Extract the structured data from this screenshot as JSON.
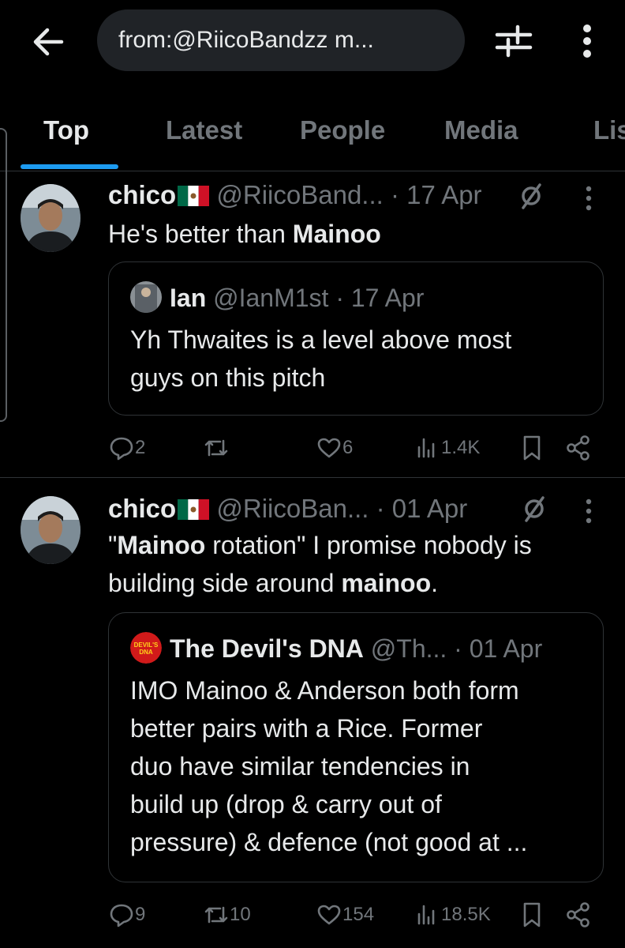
{
  "search": {
    "query": "from:@RiicoBandzz m..."
  },
  "tabs": [
    {
      "label": "Top",
      "active": true
    },
    {
      "label": "Latest"
    },
    {
      "label": "People"
    },
    {
      "label": "Media"
    },
    {
      "label": "Lis"
    }
  ],
  "tweets": [
    {
      "name": "chico",
      "handle": "@RiicoBand...",
      "date": "· 17 Apr",
      "text_parts": [
        "He's better than ",
        "Mainoo"
      ],
      "quote": {
        "name": "Ian",
        "handle": "@IanM1st",
        "date": "· 17 Apr",
        "text_lines": [
          "Yh Thwaites is a level above most",
          "guys on this pitch"
        ]
      },
      "stats": {
        "replies": "2",
        "reposts": "",
        "likes": "6",
        "views": "1.4K"
      }
    },
    {
      "name": "chico",
      "handle": "@RiicoBan...",
      "date": "· 01 Apr",
      "text_parts": [
        "\"",
        "Mainoo",
        " rotation\" I promise nobody is",
        "building side around ",
        "mainoo",
        "."
      ],
      "quote": {
        "name": "The Devil's DNA",
        "handle": "@Th...",
        "date": "· 01 Apr",
        "avatar_text": "DEVIL'S DNA",
        "text_lines": [
          "IMO Mainoo & Anderson both form",
          "better pairs with a Rice. Former",
          "duo have similar tendencies in",
          "build up (drop & carry out of",
          "pressure) & defence (not good at ..."
        ]
      },
      "stats": {
        "replies": "9",
        "reposts": "10",
        "likes": "154",
        "views": "18.5K"
      }
    }
  ],
  "colors": {
    "accent": "#1d9bf0",
    "muted": "#71767b",
    "text": "#e7e9ea",
    "border": "#2f3336",
    "background": "#000000"
  },
  "icons": [
    "back-arrow-icon",
    "filter-sliders-icon",
    "more-vertical-icon",
    "flag-mexico-icon",
    "grok-icon",
    "reply-icon",
    "repost-icon",
    "like-icon",
    "views-icon",
    "bookmark-icon",
    "share-icon"
  ]
}
